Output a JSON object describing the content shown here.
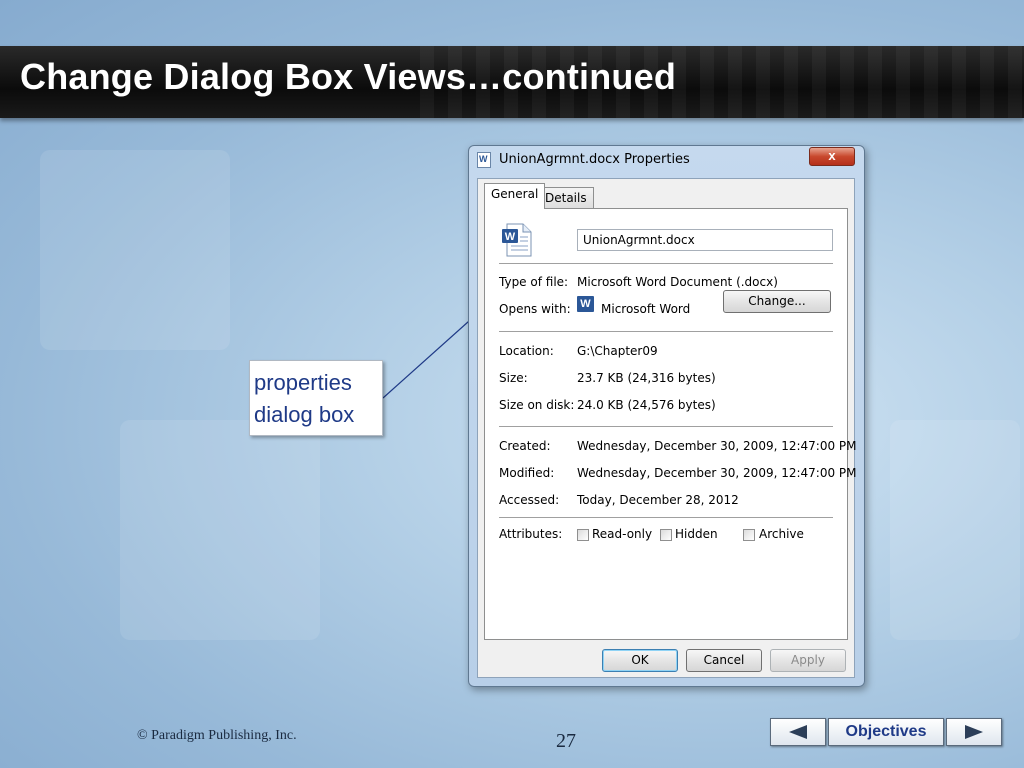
{
  "slide": {
    "title": "Change Dialog Box Views…continued",
    "callout_line1": "properties",
    "callout_line2": "dialog box",
    "copyright": "© Paradigm Publishing, Inc.",
    "page_number": "27",
    "nav": {
      "objectives_label": "Objectives"
    }
  },
  "dialog": {
    "title": "UnionAgrmnt.docx Properties",
    "close_label": "x",
    "tabs": [
      {
        "label": "General"
      },
      {
        "label": "Details"
      }
    ],
    "file_name": "UnionAgrmnt.docx",
    "rows": {
      "type_label": "Type of file:",
      "type_value": "Microsoft Word Document (.docx)",
      "opens_label": "Opens with:",
      "opens_value": "Microsoft Word",
      "change_label": "Change...",
      "location_label": "Location:",
      "location_value": "G:\\Chapter09",
      "size_label": "Size:",
      "size_value": "23.7 KB (24,316 bytes)",
      "disk_label": "Size on disk:",
      "disk_value": "24.0 KB (24,576 bytes)",
      "created_label": "Created:",
      "created_value": "Wednesday, December 30, 2009, 12:47:00 PM",
      "modified_label": "Modified:",
      "modified_value": "Wednesday, December 30, 2009, 12:47:00 PM",
      "accessed_label": "Accessed:",
      "accessed_value": "Today, December 28, 2012",
      "attributes_label": "Attributes:"
    },
    "attributes": [
      {
        "label": "Read-only",
        "checked": false
      },
      {
        "label": "Hidden",
        "checked": false
      },
      {
        "label": "Archive",
        "checked": false
      }
    ],
    "buttons": {
      "ok": "OK",
      "cancel": "Cancel",
      "apply": "Apply"
    },
    "word_icon_letter": "W"
  }
}
